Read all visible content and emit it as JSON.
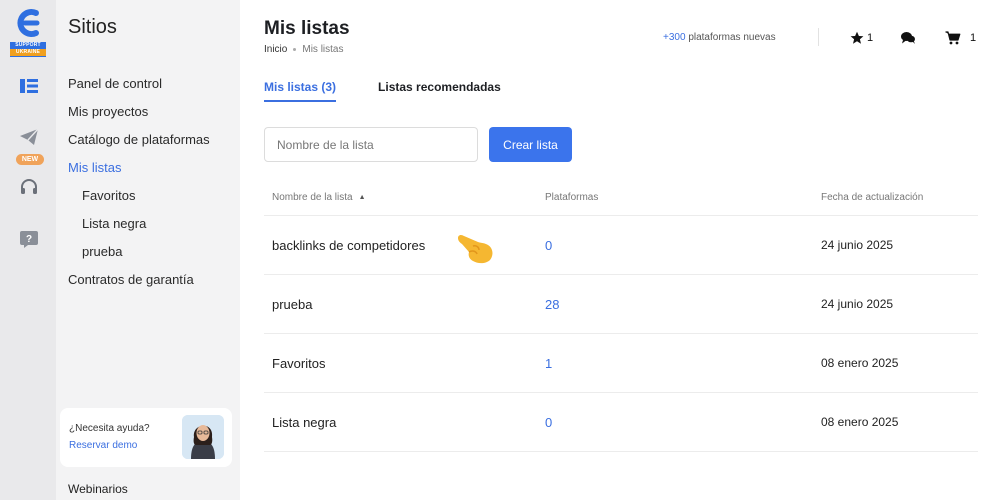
{
  "rail": {
    "logo_badge_top": "SUPPORT",
    "logo_badge_bottom": "UKRAINE",
    "new_tag": "NEW",
    "icons": [
      "list-icon",
      "send-icon",
      "headset-icon",
      "help-chat-icon"
    ]
  },
  "sidebar": {
    "title": "Sitios",
    "items": [
      {
        "label": "Panel de control",
        "active": false,
        "sub": false
      },
      {
        "label": "Mis proyectos",
        "active": false,
        "sub": false
      },
      {
        "label": "Catálogo de plataformas",
        "active": false,
        "sub": false
      },
      {
        "label": "Mis listas",
        "active": true,
        "sub": false
      },
      {
        "label": "Favoritos",
        "active": false,
        "sub": true
      },
      {
        "label": "Lista negra",
        "active": false,
        "sub": true
      },
      {
        "label": "prueba",
        "active": false,
        "sub": true
      },
      {
        "label": "Contratos de garantía",
        "active": false,
        "sub": false
      }
    ],
    "help": {
      "question": "¿Necesita ayuda?",
      "link": "Reservar demo"
    },
    "webinars": "Webinarios"
  },
  "header": {
    "title": "Mis listas",
    "breadcrumb": {
      "home": "Inicio",
      "current": "Mis listas"
    },
    "new_platforms_count": "+300",
    "new_platforms_text": "plataformas nuevas",
    "favorites_count": "1",
    "cart_count": "1"
  },
  "tabs": [
    {
      "label": "Mis listas (3)",
      "active": true
    },
    {
      "label": "Listas recomendadas",
      "active": false
    }
  ],
  "form": {
    "placeholder": "Nombre de la lista",
    "create_label": "Crear lista"
  },
  "table": {
    "columns": [
      "Nombre de la lista",
      "Plataformas",
      "Fecha de actualización"
    ],
    "rows": [
      {
        "name": "backlinks de competidores",
        "platforms": "0",
        "date": "24 junio 2025"
      },
      {
        "name": "prueba",
        "platforms": "28",
        "date": "24 junio 2025"
      },
      {
        "name": "Favoritos",
        "platforms": "1",
        "date": "08 enero 2025"
      },
      {
        "name": "Lista negra",
        "platforms": "0",
        "date": "08 enero 2025"
      }
    ]
  },
  "colors": {
    "accent": "#3b6fe0",
    "button": "#3b74ec",
    "new_tag": "#f0a35a",
    "hand": "#f5b731"
  }
}
